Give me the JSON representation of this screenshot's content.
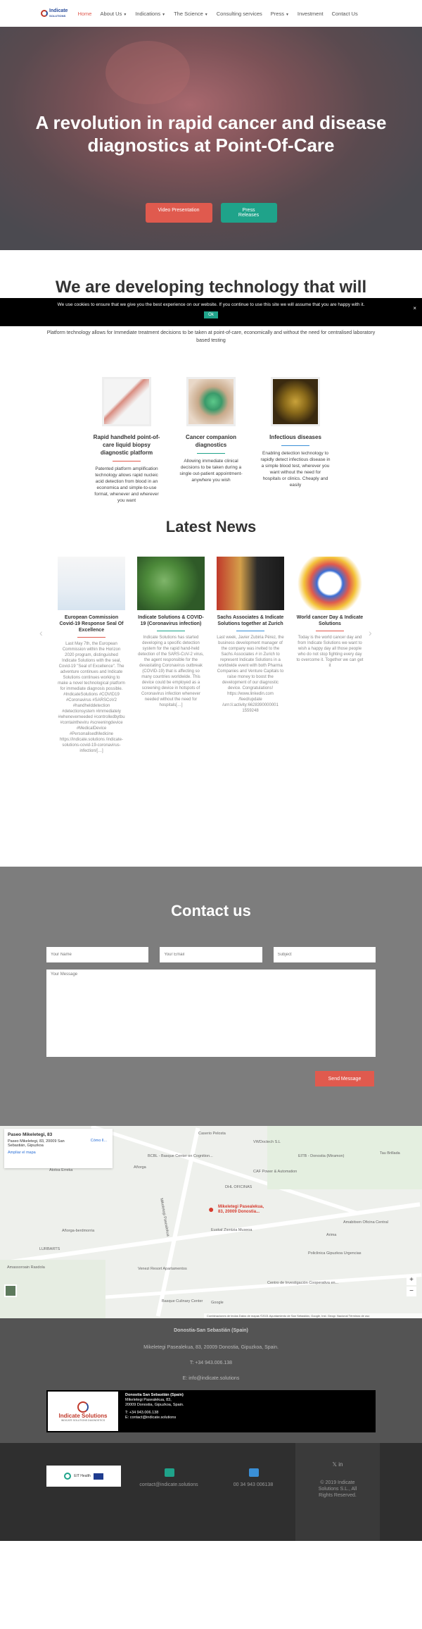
{
  "header": {
    "logo_text": "Indicate",
    "logo_text2": "SOLUTIONS",
    "nav": [
      {
        "label": "Home",
        "active": true,
        "caret": false
      },
      {
        "label": "About Us",
        "caret": true
      },
      {
        "label": "Indications",
        "caret": true
      },
      {
        "label": "The Science",
        "caret": true
      },
      {
        "label": "Consulting services",
        "caret": false
      },
      {
        "label": "Press",
        "caret": true
      },
      {
        "label": "Investment",
        "caret": false
      },
      {
        "label": "Contact Us",
        "caret": false
      }
    ]
  },
  "hero": {
    "title": "A revolution in rapid cancer and disease diagnostics at Point-Of-Care",
    "btn_video": "Video Presentation",
    "btn_press": "Press Releases"
  },
  "dev": {
    "heading": "We are developing technology that will",
    "subtitle": "Platform technology allows for Immediate treatment decisions to be taken at point-of-care, economically and without the need for centralised laboratory based testing",
    "features": [
      {
        "title": "Rapid handheld point-of-care liquid biopsy diagnostic platform",
        "text": "Patented platform amplification technology allows rapid nucleic acid detection from blood in an economica and simple-to-use format, whenever and wherever you want",
        "line": "#e05a4e"
      },
      {
        "title": "Cancer companion diagnostics",
        "text": "Allowing immediate clinical decisions to be taken during a single out-patient appointment- anywhere you wish",
        "line": "#1fa38a"
      },
      {
        "title": "Infectious diseases",
        "text": "Enabling detection technology to rapidly detect infectious disease in a simple blood test, wherever you want without the need for hospitals or clinics. Cheaply and easily",
        "line": "#3a8fd6"
      }
    ]
  },
  "cookie": {
    "text": "We use cookies to ensure that we give you the best experience on our website. If you continue to use this site we will assume that you are happy with it.",
    "ok": "Ok",
    "close": "×"
  },
  "news": {
    "title": "Latest News",
    "prev": "‹",
    "next": "›",
    "items": [
      {
        "title": "European Commission Covid-19 Response Seal Of Excellence",
        "line": "#e05a4e",
        "text": "Last May 7th, the European Commission within the Horizon 2020 program, distinguished Indicate Solutions with the seal, Covid-19 \"Seal of Excellence\". The adventure continues and Indicate Solutions continues working to make a novel technological platform for immediate diagnosis possible. #IndicateSolutions #COVID19 #Coronavirus #SARSCoV2 #handhelddetection #detectionsystem #immediately #wheneverneeded #controlledbytbu #containtheviru #screeningdevice #MedicalDevice #PersonalisedMedicine https://indicate.solutions /indicate-solutions-covid-19-coronavirus-infection/[…]"
      },
      {
        "title": "Indicate Solutions & COVID-19 (Coronavirus infection)",
        "line": "#1fa38a",
        "text": "Indicate Solutions has started developing a specific detection system for the rapid hand-held detection of the SARS-CoV-2 virus, the agent responsible for the devastating Coronavirus outbreak (COVID-19) that is affecting so many countries worldwide. This device could be employed as a screening device in hotspots of Coronavirus infection whenever needed without the need for hospitals[…]"
      },
      {
        "title": "Sachs Associates & Indicate Solutions together at Zurich",
        "line": "#3a8fd6",
        "text": "Last week, Javier Zubiria Pérez, the business development manager of the company was invited to the Sachs Associates # in Zurich to represent Indicate Solutions in a worldwide event with both Pharma Companies and Venture Capitals to raise money to boost the development of our diagnostic device. Congratulations! https://www.linkedin.com /feed/update /urn:li:activity:6628390000001 1559248"
      },
      {
        "title": "World cancer Day & Indicate Solutions",
        "line": "#e05a4e",
        "text": "Today is the world cancer day and from Indicate Solutions we want to wish a happy day all those people who do not stop fighting every day to overcome it. Together we can get it"
      }
    ]
  },
  "contact": {
    "title": "Contact us",
    "name_ph": "Your Name",
    "email_ph": "Your Email",
    "subject_ph": "Subject",
    "message_ph": "Your Message",
    "send": "Send Message"
  },
  "map": {
    "card_title": "Paseo Mikeletegi, 83",
    "card_address": "Paseo Mikeletegi, 83, 20009 San Sebastián, Gipuzkoa",
    "card_dir": "Cómo ll...",
    "card_link": "Ampliar el mapa",
    "pin_label": "Mikeletegi Pasealekua, 83, 20009 Donostia...",
    "labels": [
      "Caserio Pelosta",
      "VWDoctech S.L",
      "BCBL - Basque Center on Cognition...",
      "EITB - Donostia (Miramon)",
      "Añorga",
      "CAF Power & Automation",
      "Tau Brillada",
      "Atotxa Erreka",
      "Mikeletegi Pasealekua",
      "DHL OFICINAS",
      "Euskal Zientzia Museoa",
      "Arima",
      "Amabitxen Oficina Central",
      "Añorga-berdmorria",
      "LURBARTS",
      "Policlinica Gipuzkoa Urgencias",
      "Amassoroain Rasdola",
      "Venezi Resort Apartamentos",
      "Centro de Investigación Cooperativa en...",
      "Basque Culinary Center",
      "Google"
    ],
    "footer": "Combinaciones de teclas   Datos de mapas ©2021 Ayuntamiento de San Sebastián, Google, Inst. Geogr. Nacional   Términos de uso",
    "zoom_in": "+",
    "zoom_out": "−"
  },
  "footer1": {
    "city": "Donostia-San Sebastián (Spain)",
    "address": "Mikeletegi Pasealekua, 83, 20009 Donostia, Gipuzkoa, Spain.",
    "phone": "T: +34 943.006.138",
    "email": "E: info@indicate.solutions",
    "card_logo": "Indicate Solutions",
    "card_logo_sub": "INDICATE SOLUTIONS DIAGNOSTICS",
    "card_city": "Donostia San Sebastián (Spain)",
    "card_address": "Mikeletegi Pasealekua, 83,",
    "card_address2": "20009 Donostia, Gipuzkoa, Spain.",
    "card_phone": "T: +34 943.006.138",
    "card_email": "E: contact@indicate.solutions"
  },
  "footer2": {
    "eu_logo_text": "EIT Health",
    "email": "contact@indicate.solutions",
    "phone": "00 34 943 006138",
    "social": "𝕏  in",
    "copyright": "© 2019 Indicate Solutions S.L., All Rights Reserved."
  },
  "colors": {
    "accent_red": "#e05a4e",
    "accent_green": "#1fa38a",
    "accent_blue": "#3a8fd6"
  }
}
